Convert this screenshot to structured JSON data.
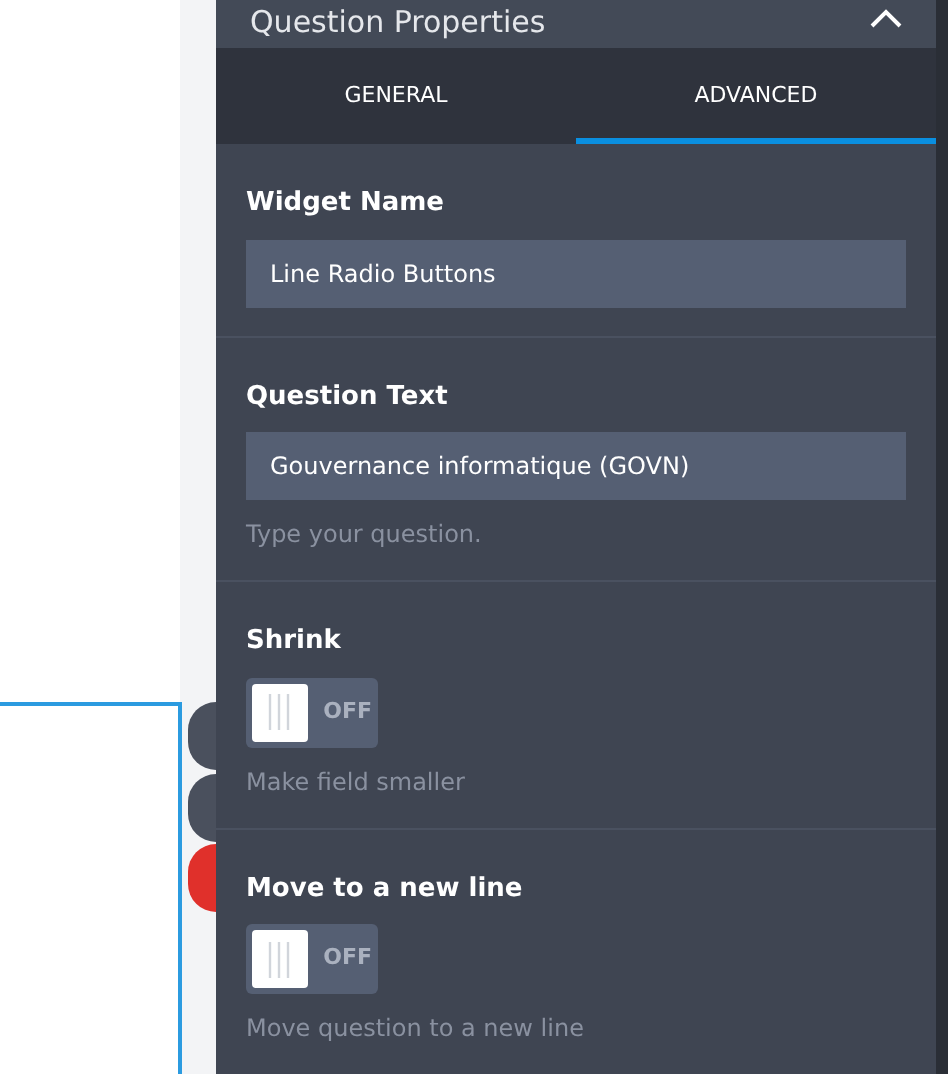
{
  "panel": {
    "title": "Question Properties"
  },
  "tabs": [
    {
      "label": "GENERAL",
      "selected": false
    },
    {
      "label": "ADVANCED",
      "selected": true
    }
  ],
  "fields": [
    {
      "kind": "text",
      "label": "Widget Name",
      "value": "Line Radio Buttons"
    },
    {
      "kind": "text",
      "label": "Question Text",
      "value": "Gouvernance informatique (GOVN)",
      "hint": "Type your question."
    },
    {
      "kind": "toggle",
      "label": "Shrink",
      "on": false,
      "state_label": "OFF",
      "hint": "Make field smaller"
    },
    {
      "kind": "toggle",
      "label": "Move to a new line",
      "on": false,
      "state_label": "OFF",
      "hint": "Move question to a new line"
    }
  ]
}
